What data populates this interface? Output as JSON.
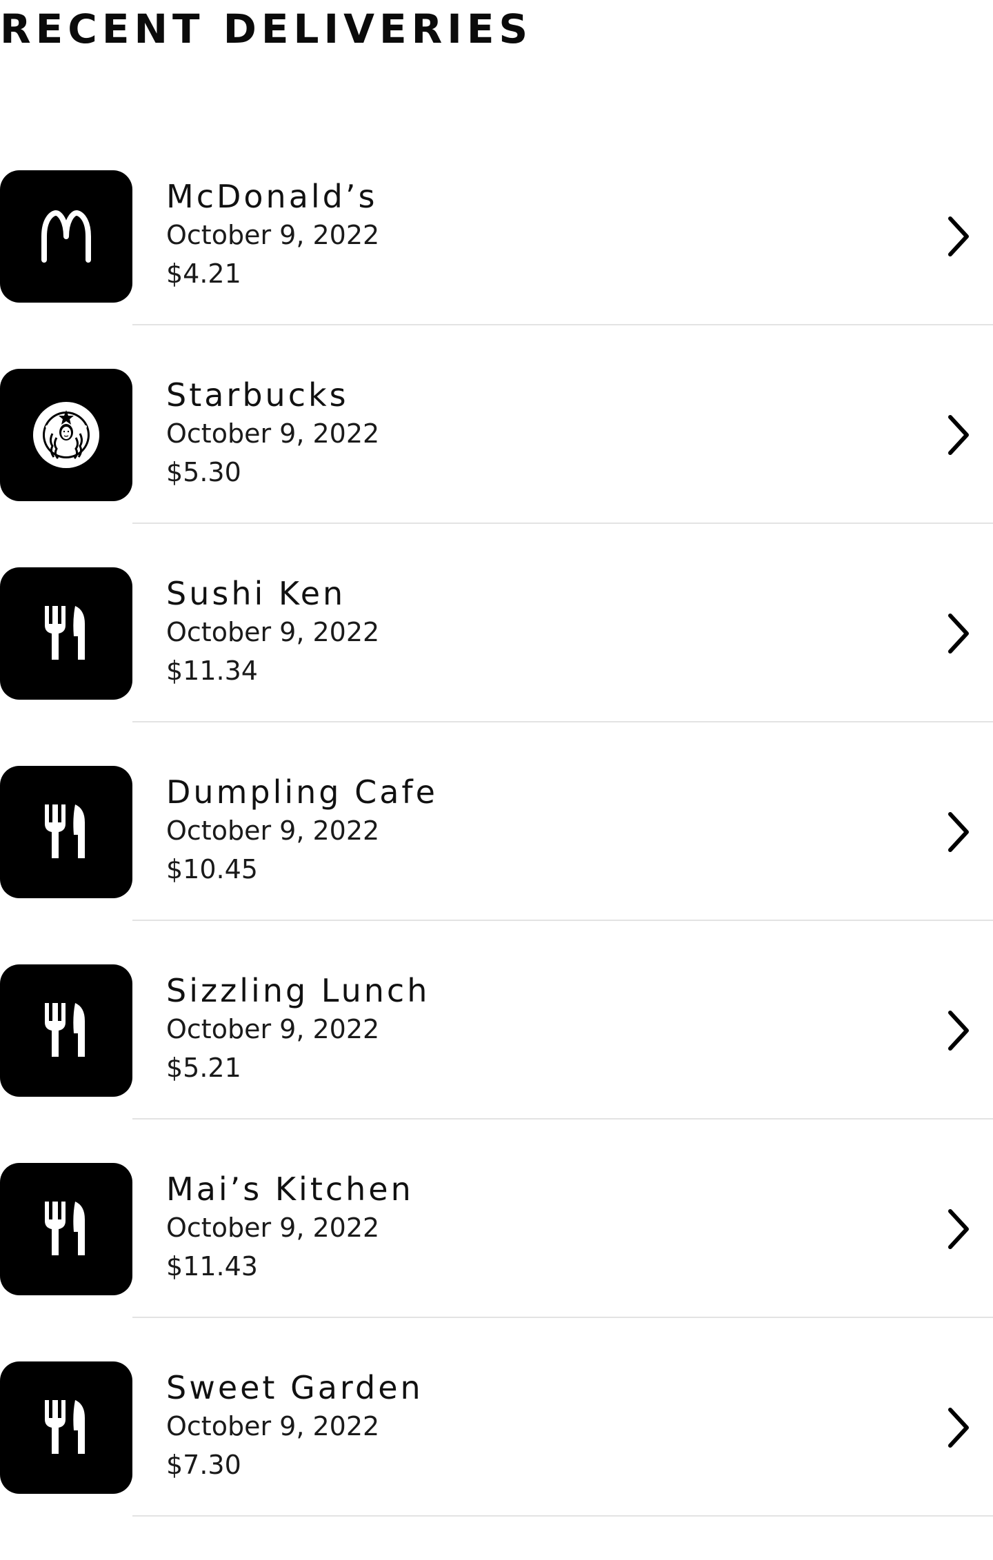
{
  "page": {
    "title": "RECENT DELIVERIES"
  },
  "colors": {
    "tile_background": "#000000",
    "divider": "#e3e3e3",
    "text": "#111111"
  },
  "deliveries": [
    {
      "name": "McDonald’s",
      "date": "October 9, 2022",
      "amount": "$4.21",
      "icon": "mcdonalds-logo-icon"
    },
    {
      "name": "Starbucks",
      "date": "October 9, 2022",
      "amount": "$5.30",
      "icon": "starbucks-logo-icon"
    },
    {
      "name": "Sushi Ken",
      "date": "October 9, 2022",
      "amount": "$11.34",
      "icon": "fork-knife-icon"
    },
    {
      "name": "Dumpling Cafe",
      "date": "October 9, 2022",
      "amount": "$10.45",
      "icon": "fork-knife-icon"
    },
    {
      "name": "Sizzling Lunch",
      "date": "October 9, 2022",
      "amount": "$5.21",
      "icon": "fork-knife-icon"
    },
    {
      "name": "Mai’s Kitchen",
      "date": "October 9, 2022",
      "amount": "$11.43",
      "icon": "fork-knife-icon"
    },
    {
      "name": "Sweet Garden",
      "date": "October 9, 2022",
      "amount": "$7.30",
      "icon": "fork-knife-icon"
    }
  ]
}
